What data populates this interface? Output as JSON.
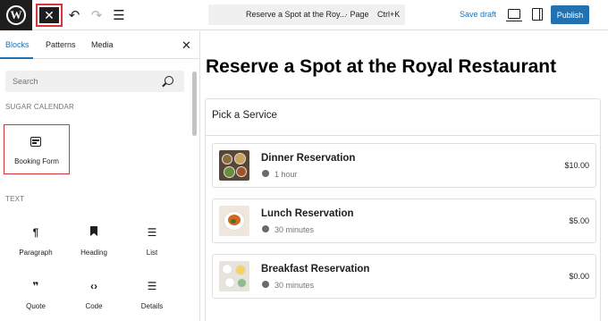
{
  "toolbar": {
    "wp_logo": "W",
    "close_glyph": "✕",
    "undo_glyph": "↶",
    "redo_glyph": "↷",
    "list_glyph": "☰",
    "doc_title": "Reserve a Spot at the Royal Restau…",
    "doc_title_display": "Reserve a Spot at the Roy...",
    "doc_type": "· Page",
    "shortcut": "Ctrl+K",
    "save_draft": "Save draft",
    "publish": "Publish"
  },
  "sidebar": {
    "tabs": [
      {
        "label": "Blocks"
      },
      {
        "label": "Patterns"
      },
      {
        "label": "Media"
      }
    ],
    "close_glyph": "✕",
    "search_placeholder": "Search",
    "categories": [
      {
        "label": "SUGAR CALENDAR",
        "blocks": [
          {
            "label": "Booking Form",
            "icon": "booking-form-icon"
          }
        ]
      },
      {
        "label": "TEXT",
        "blocks": [
          {
            "label": "Paragraph",
            "icon": "paragraph-icon",
            "glyph": "¶"
          },
          {
            "label": "Heading",
            "icon": "heading-icon",
            "glyph": "🔖"
          },
          {
            "label": "List",
            "icon": "list-icon",
            "glyph": "☰"
          },
          {
            "label": "Quote",
            "icon": "quote-icon",
            "glyph": "❞"
          },
          {
            "label": "Code",
            "icon": "code-icon",
            "glyph": "‹›"
          },
          {
            "label": "Details",
            "icon": "details-icon",
            "glyph": "☰"
          }
        ]
      }
    ]
  },
  "canvas": {
    "page_title": "Reserve a Spot at the Royal Restaurant",
    "service_heading": "Pick a Service",
    "services": [
      {
        "name": "Dinner Reservation",
        "duration": "1 hour",
        "price": "$10.00"
      },
      {
        "name": "Lunch Reservation",
        "duration": "30 minutes",
        "price": "$5.00"
      },
      {
        "name": "Breakfast Reservation",
        "duration": "30 minutes",
        "price": "$0.00"
      }
    ]
  },
  "colors": {
    "accent": "#2271b1",
    "highlight": "#d63638",
    "dark": "#1e1e1e"
  }
}
